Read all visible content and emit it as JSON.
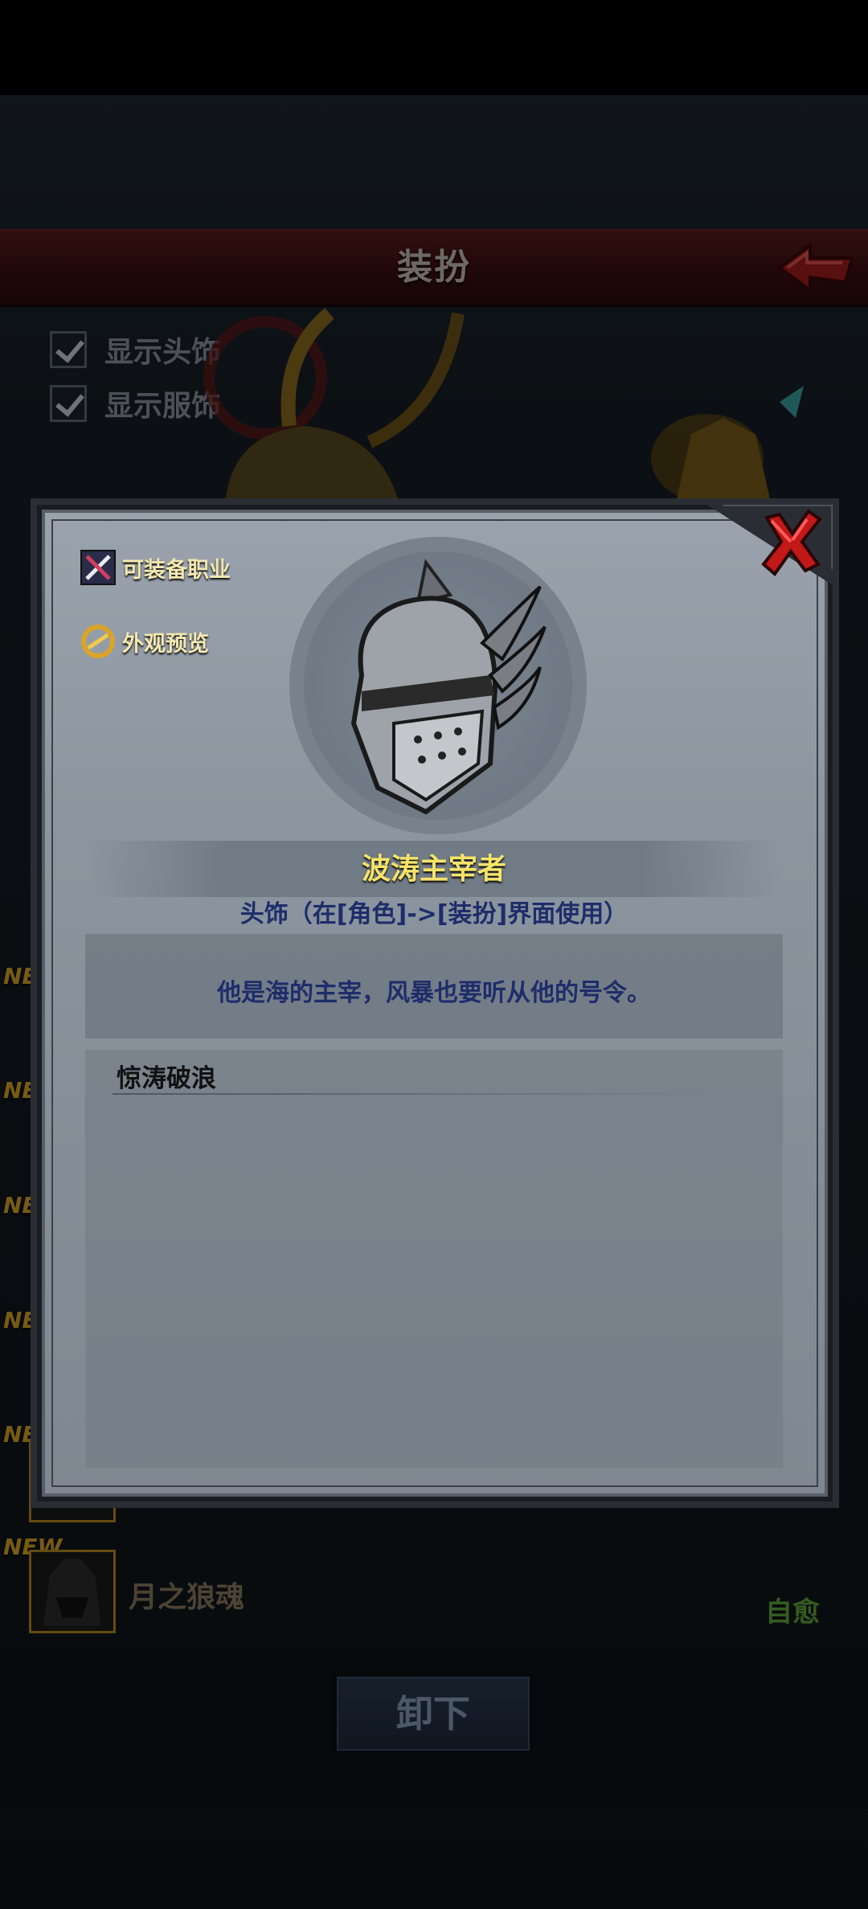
{
  "header": {
    "title": "装扮"
  },
  "options": [
    {
      "label": "显示头饰",
      "checked": true
    },
    {
      "label": "显示服饰",
      "checked": true
    }
  ],
  "list": [
    {
      "new": "NEW",
      "name": "",
      "tag": ""
    },
    {
      "new": "NEW",
      "name": "",
      "tag": ""
    },
    {
      "new": "NEW",
      "name": "",
      "tag": ""
    },
    {
      "new": "NEW",
      "name": "",
      "tag": ""
    },
    {
      "new": "NEW",
      "name": "",
      "tag": ""
    },
    {
      "new": "NEW",
      "name": "月之狼魂",
      "tag": "自愈"
    }
  ],
  "footer": {
    "unequip_label": "卸下"
  },
  "modal": {
    "links": [
      {
        "label": "可装备职业",
        "icon": "class-icon"
      },
      {
        "label": "外观预览",
        "icon": "preview-icon"
      }
    ],
    "item": {
      "name": "波涛主宰者",
      "type": "头饰（在[角色]->[装扮]界面使用）",
      "description": "他是海的主宰，风暴也要听从他的号令。",
      "skill_title": "惊涛破浪"
    },
    "close_icon": "close-icon"
  },
  "colors": {
    "title_gold": "#f4e36a",
    "text_blue": "#1e2d6a",
    "new_tag": "#d9a428",
    "green_tag": "#5fa83a"
  }
}
